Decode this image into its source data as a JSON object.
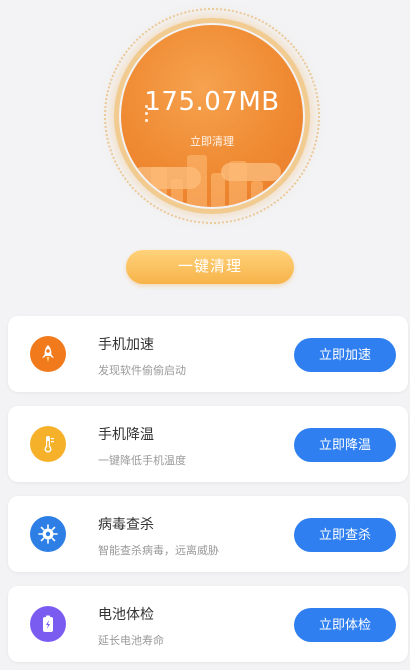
{
  "hero": {
    "junk_size": "175.07MB",
    "junk_hint": "立即清理",
    "clean_button_label": "一键清理",
    "accent_color": "#ef8a32"
  },
  "features": [
    {
      "title": "手机加速",
      "desc": "发现软件偷偷启动",
      "button": "立即加速",
      "icon": "rocket-icon",
      "icon_color": "#f07a1c"
    },
    {
      "title": "手机降温",
      "desc": "一键降低手机温度",
      "button": "立即降温",
      "icon": "thermometer-icon",
      "icon_color": "#f5b12a"
    },
    {
      "title": "病毒查杀",
      "desc": "智能查杀病毒，远离威胁",
      "button": "立即查杀",
      "icon": "virus-icon",
      "icon_color": "#2d7fe6"
    },
    {
      "title": "电池体检",
      "desc": "延长电池寿命",
      "button": "立即体检",
      "icon": "battery-icon",
      "icon_color": "#7b5cf0"
    }
  ],
  "button_color": "#2f7ff0"
}
